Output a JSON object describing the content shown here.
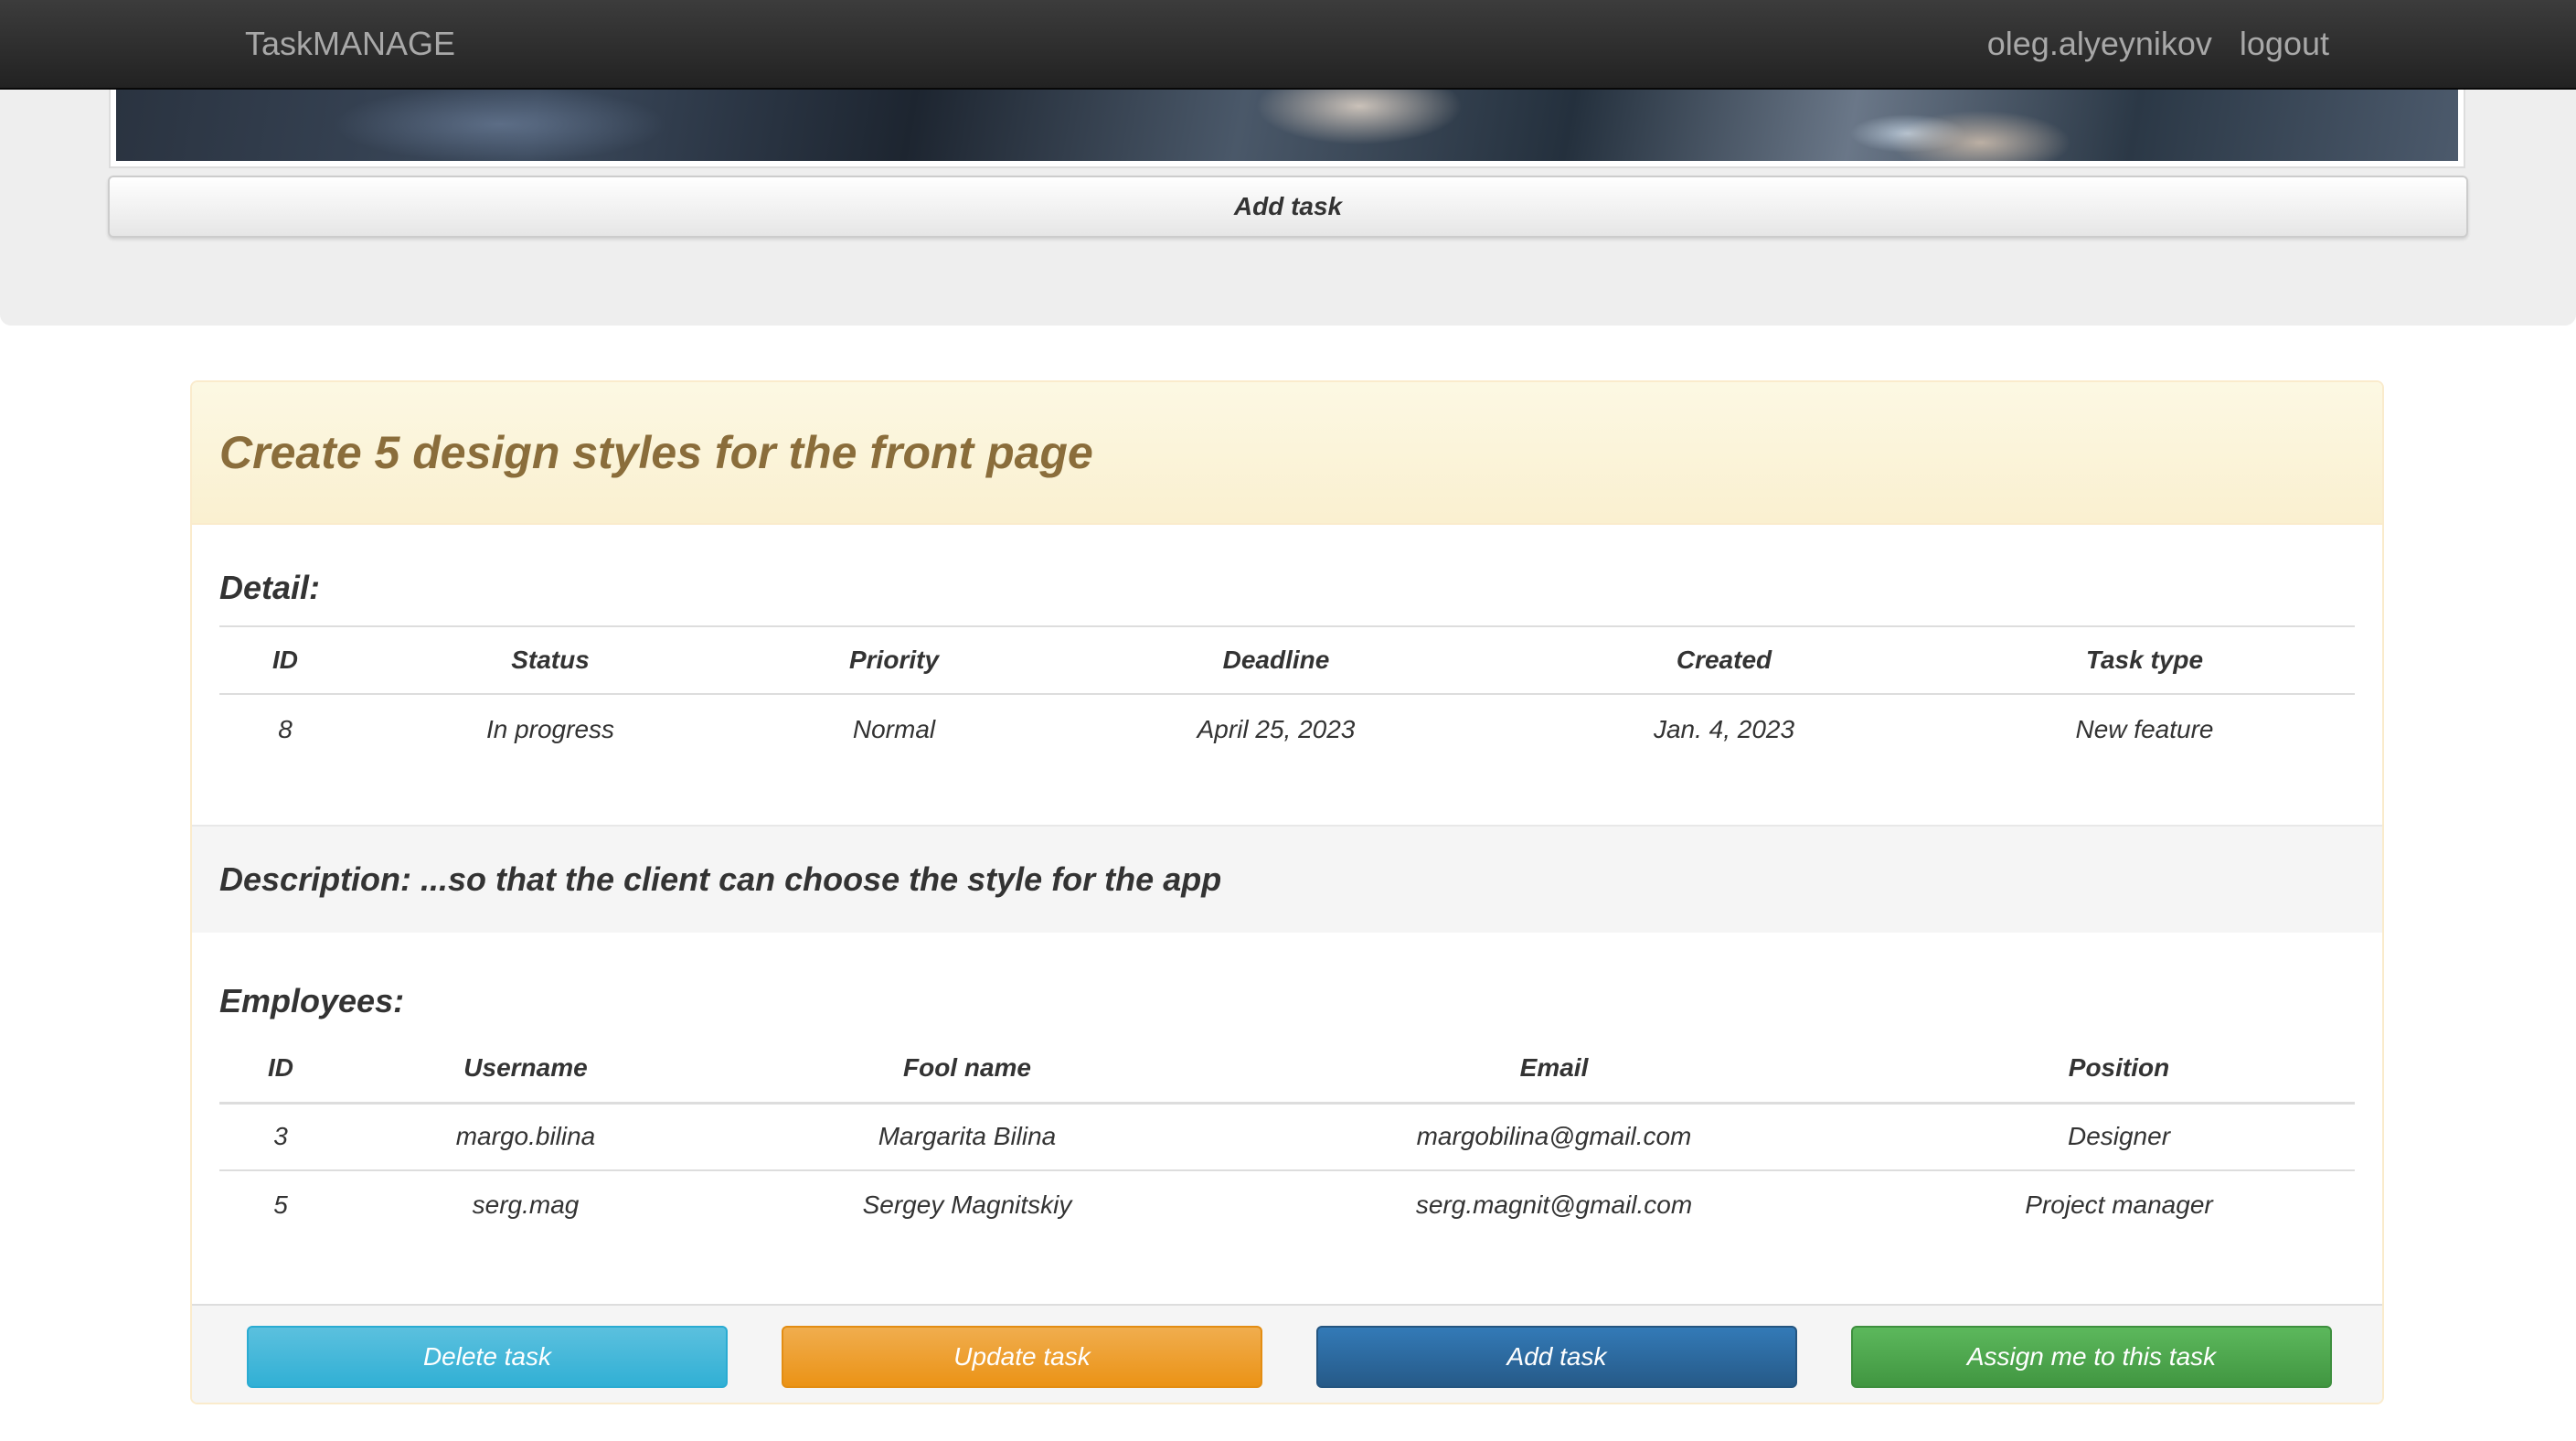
{
  "navbar": {
    "brand": "TaskMANAGE",
    "username": "oleg.alyeynikov",
    "logout_label": "logout"
  },
  "jumbotron": {
    "add_task_label": "Add task"
  },
  "task": {
    "title": "Create 5 design styles for the front page",
    "detail_heading": "Detail:",
    "detail_columns": [
      "ID",
      "Status",
      "Priority",
      "Deadline",
      "Created",
      "Task type"
    ],
    "detail_values": [
      "8",
      "In progress",
      "Normal",
      "April 25, 2023",
      "Jan. 4, 2023",
      "New feature"
    ],
    "description": "Description: ...so that the client can choose the style for the app",
    "employees_heading": "Employees:",
    "employee_columns": [
      "ID",
      "Username",
      "Fool name",
      "Email",
      "Position"
    ],
    "employees": [
      [
        "3",
        "margo.bilina",
        "Margarita Bilina",
        "margobilina@gmail.com",
        "Designer"
      ],
      [
        "5",
        "serg.mag",
        "Sergey Magnitskiy",
        "serg.magnit@gmail.com",
        "Project manager"
      ]
    ]
  },
  "actions": {
    "delete_label": "Delete task",
    "update_label": "Update task",
    "add_label": "Add task",
    "assign_label": "Assign me to this task"
  },
  "colors": {
    "navbar": "#222222",
    "panel_heading_text": "#8a6d3b",
    "btn_info": "#5bc0de",
    "btn_warning": "#f0ad4e",
    "btn_primary": "#337ab7",
    "btn_success": "#5cb85c"
  }
}
